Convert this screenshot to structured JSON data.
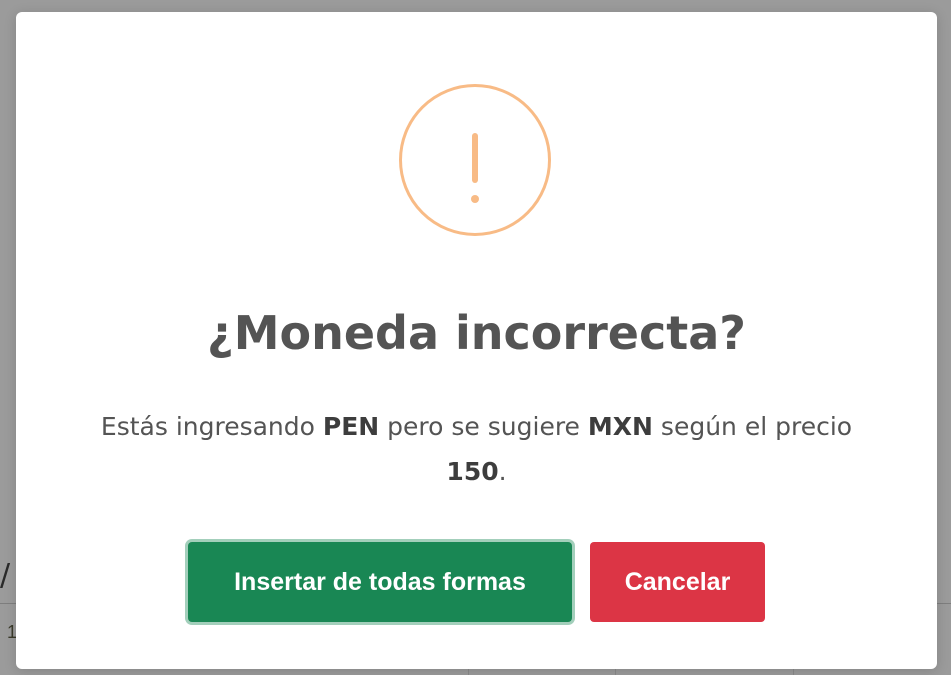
{
  "background": {
    "fragment_slash": "/",
    "fragment_one": "1"
  },
  "dialog": {
    "icon": "warning-exclamation-icon",
    "icon_color": "#f8bb86",
    "title": "¿Moneda incorrecta?",
    "message": {
      "part1": "Estás ingresando ",
      "currency_entered": "PEN",
      "part2": " pero se sugiere ",
      "currency_suggested": "MXN",
      "part3": " según el precio ",
      "price": "150",
      "part4": "."
    },
    "confirm_label": "Insertar de todas formas",
    "confirm_color": "#198754",
    "cancel_label": "Cancelar",
    "cancel_color": "#dc3545"
  }
}
